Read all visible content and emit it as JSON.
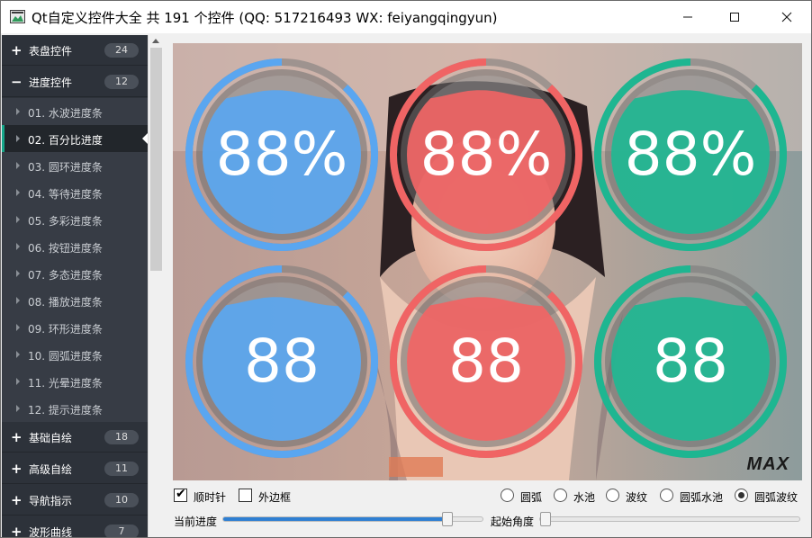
{
  "window": {
    "title": "Qt自定义控件大全 共 191 个控件 (QQ: 517216493 WX: feiyangqingyun)",
    "minimize_icon": "minimize-icon",
    "maximize_icon": "maximize-icon",
    "close_icon": "close-icon"
  },
  "nav": {
    "parents_top": [
      {
        "sign": "+",
        "label": "表盘控件",
        "count": "24"
      },
      {
        "sign": "−",
        "label": "进度控件",
        "count": "12"
      }
    ],
    "children": [
      {
        "label": "01. 水波进度条"
      },
      {
        "label": "02. 百分比进度"
      },
      {
        "label": "03. 圆环进度条"
      },
      {
        "label": "04. 等待进度条"
      },
      {
        "label": "05. 多彩进度条"
      },
      {
        "label": "06. 按钮进度条"
      },
      {
        "label": "07. 多态进度条"
      },
      {
        "label": "08. 播放进度条"
      },
      {
        "label": "09. 环形进度条"
      },
      {
        "label": "10. 圆弧进度条"
      },
      {
        "label": "11. 光晕进度条"
      },
      {
        "label": "12. 提示进度条"
      }
    ],
    "active_index": 1,
    "parents_bottom": [
      {
        "sign": "+",
        "label": "基础自绘",
        "count": "18"
      },
      {
        "sign": "+",
        "label": "高级自绘",
        "count": "11"
      },
      {
        "sign": "+",
        "label": "导航指示",
        "count": "10"
      },
      {
        "sign": "+",
        "label": "波形曲线",
        "count": "7"
      }
    ]
  },
  "gauges": [
    {
      "text": "88%",
      "color": "#5aa6f0",
      "progress": 0.88
    },
    {
      "text": "88%",
      "color": "#f06464",
      "progress": 0.88
    },
    {
      "text": "88%",
      "color": "#1eb691",
      "progress": 0.88
    },
    {
      "text": "88",
      "color": "#5aa6f0",
      "progress": 0.88
    },
    {
      "text": "88",
      "color": "#f06464",
      "progress": 0.88
    },
    {
      "text": "88",
      "color": "#1eb691",
      "progress": 0.88
    }
  ],
  "watermark": "MAX",
  "controls": {
    "clockwise": {
      "label": "顺时针",
      "checked": true
    },
    "outer_border": {
      "label": "外边框",
      "checked": false
    },
    "styles": [
      {
        "label": "圆弧",
        "selected": false
      },
      {
        "label": "水池",
        "selected": false
      },
      {
        "label": "波纹",
        "selected": false
      },
      {
        "label": "圆弧水池",
        "selected": false
      },
      {
        "label": "圆弧波纹",
        "selected": true
      }
    ],
    "current_progress": {
      "label": "当前进度",
      "value": 88,
      "min": 0,
      "max": 100
    },
    "start_angle": {
      "label": "起始角度",
      "value": 0
    }
  }
}
